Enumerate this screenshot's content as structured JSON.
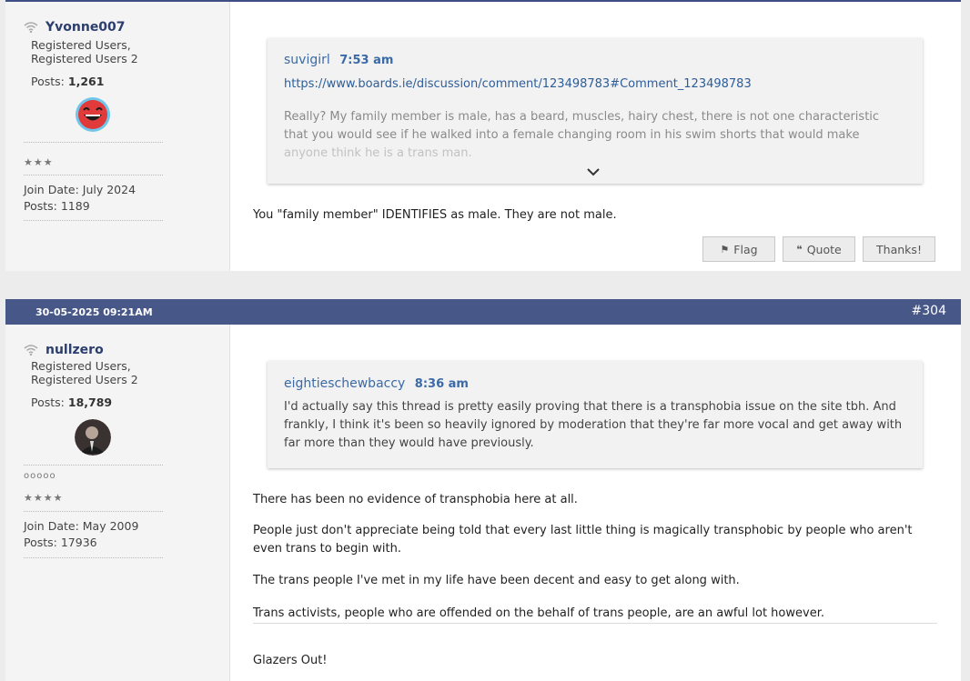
{
  "post1": {
    "author": {
      "username": "Yvonne007",
      "role_line1": "Registered Users,",
      "role_line2": "Registered Users 2",
      "posts_label": "Posts:",
      "posts_count": "1,261",
      "rank_stars": "★★★",
      "join_date": "Join Date: July 2024",
      "posts_total": "Posts: 1189",
      "avatar_icon": "smiley-face-icon"
    },
    "quote": {
      "author": "suvigirl",
      "time": "7:53 am",
      "link": "https://www.boards.ie/discussion/comment/123498783#Comment_123498783",
      "text_line1": "Really? My family member is male, has a beard, muscles, hairy chest, there is not one characteristic",
      "text_line2": "that you would see if he walked into a female changing room in his swim shorts that would make",
      "text_line3": "anyone think he is a trans man."
    },
    "body": "You \"family member\" IDENTIFIES as male. They are not male.",
    "buttons": {
      "flag": "Flag",
      "quote": "Quote",
      "thanks": "Thanks!"
    }
  },
  "post2": {
    "date": "30-05-2025 09:21AM",
    "number": "#304",
    "author": {
      "username": "nullzero",
      "role_line1": "Registered Users,",
      "role_line2": "Registered Users 2",
      "posts_label": "Posts:",
      "posts_count": "18,789",
      "badges": "ooooo",
      "rank_stars": "★★★★",
      "join_date": "Join Date: May 2009",
      "posts_total": "Posts: 17936"
    },
    "quote": {
      "author": "eightieschewbaccy",
      "time": "8:36 am",
      "text": "I'd actually say this thread is pretty easily proving that there is a transphobia issue on the site tbh. And frankly, I think it's been so heavily ignored by moderation that they're far more vocal and get away with far more than they would have previously."
    },
    "paragraphs": [
      "There has been no evidence of transphobia here at all.",
      "People just don't appreciate being told that every last little thing is magically transphobic by people who aren't even trans to begin with.",
      "The trans people I've met in my life have been decent and easy to get along with.",
      "Trans activists, people who are offended on the behalf of trans people, are an awful lot however."
    ],
    "signature": "Glazers Out!"
  }
}
